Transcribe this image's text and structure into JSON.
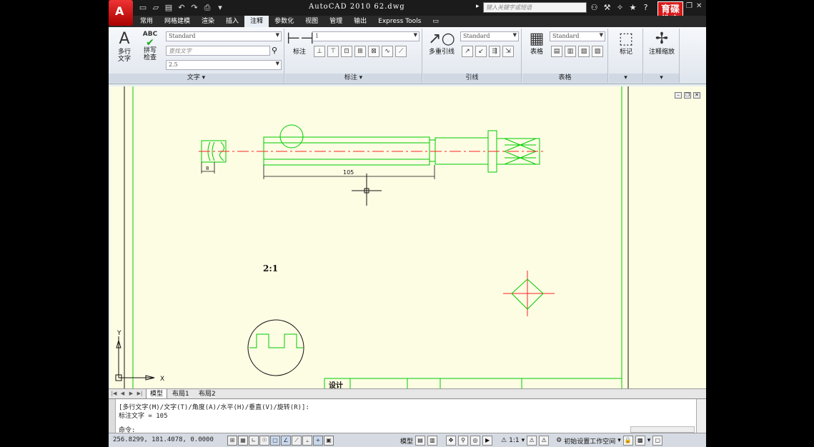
{
  "title_bar": {
    "app_title": "AutoCAD 2010   62.dwg",
    "search_placeholder": "键入关键字或短语",
    "brand_line1": "育碟",
    "brand_line2": "教育",
    "app_button_letter": "A"
  },
  "ribbon_tabs": [
    "常用",
    "网格建模",
    "渲染",
    "插入",
    "注释",
    "参数化",
    "视图",
    "管理",
    "输出",
    "Express Tools"
  ],
  "active_tab_index": 4,
  "ribbon": {
    "text_panel": {
      "title": "文字",
      "mtext_label": "多行\n文字",
      "spell_label": "拼写\n检查",
      "spell_icon_text": "ABC",
      "style_value": "Standard",
      "find_placeholder": "查找文字",
      "height_value": "2.5"
    },
    "dim_panel": {
      "title": "标注",
      "dim_label": "标注",
      "style_value": "1"
    },
    "leader_panel": {
      "title": "引线",
      "mleader_label": "多重引线",
      "style_value": "Standard"
    },
    "table_panel": {
      "title": "表格",
      "table_label": "表格",
      "style_value": "Standard"
    },
    "markup_panel": {
      "label": "标记"
    },
    "scale_panel": {
      "label": "注释缩放"
    }
  },
  "drawing": {
    "dim_small": "8",
    "dim_length": "105",
    "scale_note": "2:1",
    "table_text": "设计",
    "ucs_x": "X",
    "ucs_y": "Y"
  },
  "layout_tabs": [
    "模型",
    "布局1",
    "布局2"
  ],
  "command_line": {
    "line1": "[多行文字(M)/文字(T)/角度(A)/水平(H)/垂直(V)/旋转(R)]:",
    "line2": "标注文字 = 105",
    "line3": "命令:"
  },
  "status_bar": {
    "coords": "256.8299, 181.4078, 0.0000",
    "model_label": "模型",
    "scale_label": "1:1",
    "workspace_label": "初始设置工作空间"
  },
  "colors": {
    "drawing_bg": "#fdfde4",
    "geometry": "#00cc00",
    "centerline": "#ff2222",
    "title_bar": "#1b1b1b"
  }
}
